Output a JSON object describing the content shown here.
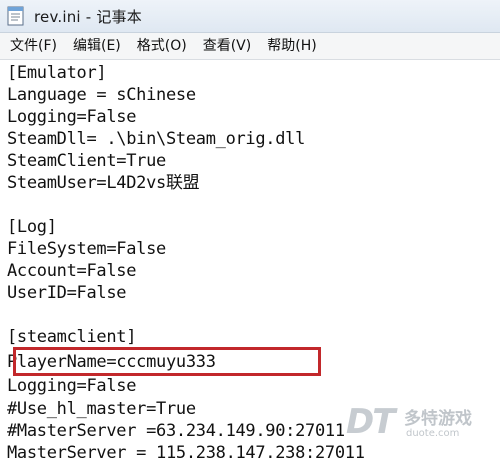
{
  "window": {
    "title": "rev.ini - 记事本"
  },
  "menu": {
    "items": [
      "文件(F)",
      "编辑(E)",
      "格式(O)",
      "查看(V)",
      "帮助(H)"
    ]
  },
  "editor": {
    "lines": [
      "[Emulator]",
      "Language = sChinese",
      "Logging=False",
      "SteamDll= .\\bin\\Steam_orig.dll",
      "SteamClient=True",
      "SteamUser=L4D2vs联盟",
      "",
      "[Log]",
      "FileSystem=False",
      "Account=False",
      "UserID=False",
      "",
      "[steamclient]",
      "PlayerName=cccmuyu333",
      "Logging=False",
      "#Use_hl_master=True",
      "#MasterServer =63.234.149.90:27011",
      "MasterServer = 115.238.147.238:27011"
    ]
  },
  "watermark": {
    "logo": "DT",
    "name": "多特游戏",
    "url": "duote.com"
  },
  "colors": {
    "highlight_border": "#c2282b"
  },
  "icons": {
    "app": "notepad-icon"
  }
}
